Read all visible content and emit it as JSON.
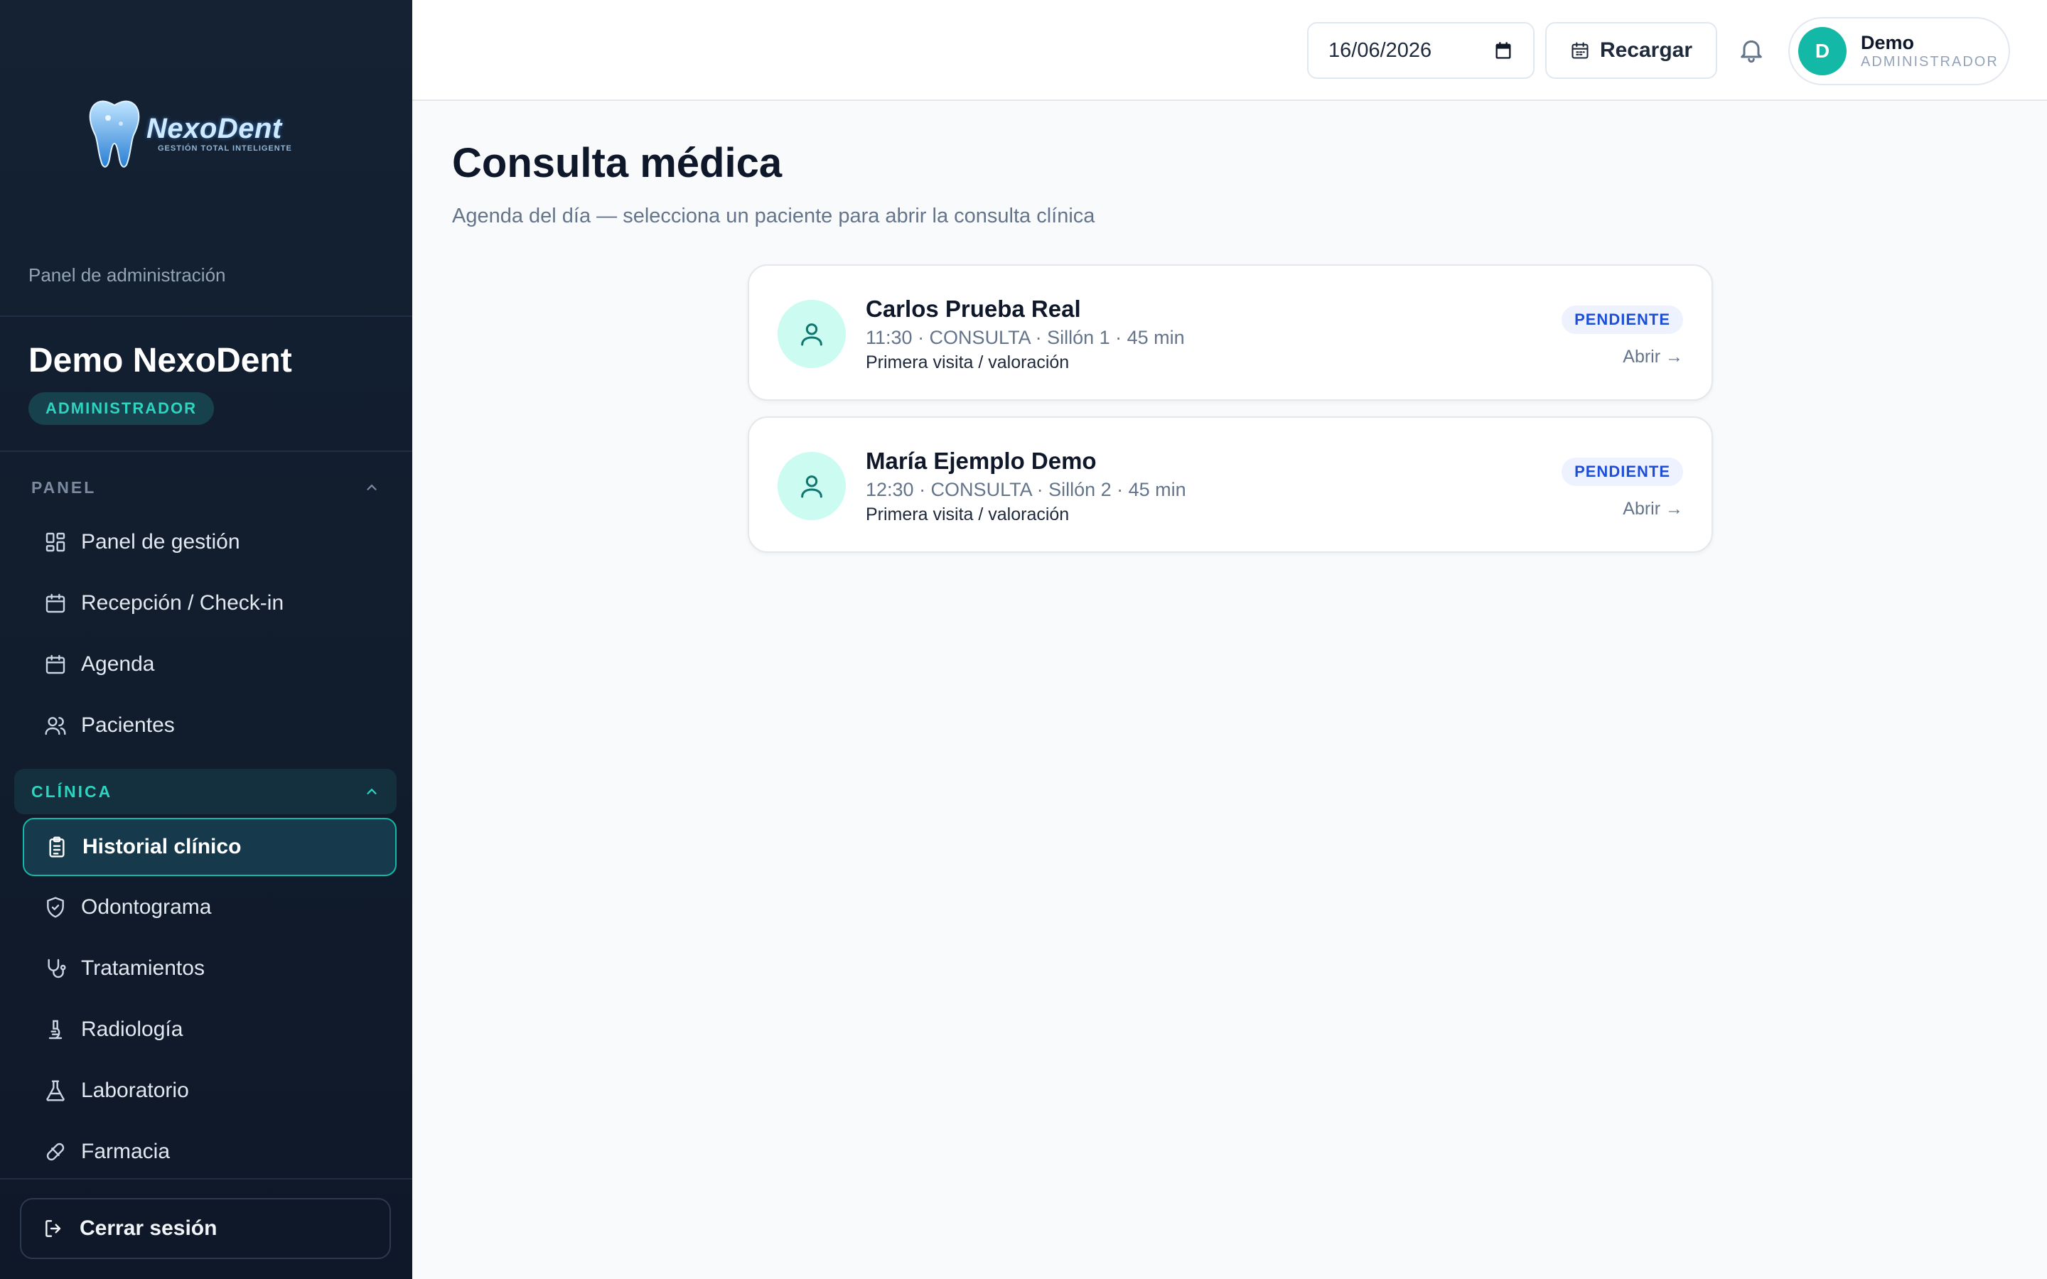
{
  "sidebar": {
    "logo": {
      "name": "NexoDent",
      "tagline": "GESTIÓN TOTAL INTELIGENTE"
    },
    "caption": "Panel de administración",
    "user_name": "Demo NexoDent",
    "role": "ADMINISTRADOR",
    "sections": {
      "panel": {
        "label": "PANEL",
        "items": [
          {
            "label": "Panel de gestión",
            "icon": "dashboard-icon"
          },
          {
            "label": "Recepción / Check-in",
            "icon": "calendar-icon"
          },
          {
            "label": "Agenda",
            "icon": "calendar-icon"
          },
          {
            "label": "Pacientes",
            "icon": "users-icon"
          }
        ]
      },
      "clinic": {
        "label": "CLÍNICA",
        "items": [
          {
            "label": "Historial clínico",
            "icon": "clipboard-icon",
            "active": true
          },
          {
            "label": "Odontograma",
            "icon": "shield-icon"
          },
          {
            "label": "Tratamientos",
            "icon": "stethoscope-icon"
          },
          {
            "label": "Radiología",
            "icon": "microscope-icon"
          },
          {
            "label": "Laboratorio",
            "icon": "flask-icon"
          },
          {
            "label": "Farmacia",
            "icon": "pill-icon"
          }
        ]
      }
    },
    "logout_label": "Cerrar sesión"
  },
  "topbar": {
    "date_value": "16/06/2026",
    "reload_label": "Recargar",
    "user": {
      "initial": "D",
      "name": "Demo",
      "role": "ADMINISTRADOR"
    }
  },
  "main": {
    "title": "Consulta médica",
    "subtitle": "Agenda del día — selecciona un paciente para abrir la consulta clínica",
    "appointments": [
      {
        "name": "Carlos Prueba Real",
        "meta": "11:30 · CONSULTA · Sillón 1 · 45 min",
        "reason": "Primera visita / valoración",
        "status": "PENDIENTE",
        "action": "Abrir →"
      },
      {
        "name": "María Ejemplo Demo",
        "meta": "12:30 · CONSULTA · Sillón 2 · 45 min",
        "reason": "Primera visita / valoración",
        "status": "PENDIENTE",
        "action": "Abrir →"
      }
    ]
  },
  "colors": {
    "sidebar_bg": "#142234",
    "accent": "#14b8a6",
    "active_bg": "#163a4c",
    "status_text": "#1d4ed8",
    "status_bg": "#eef2ff"
  }
}
